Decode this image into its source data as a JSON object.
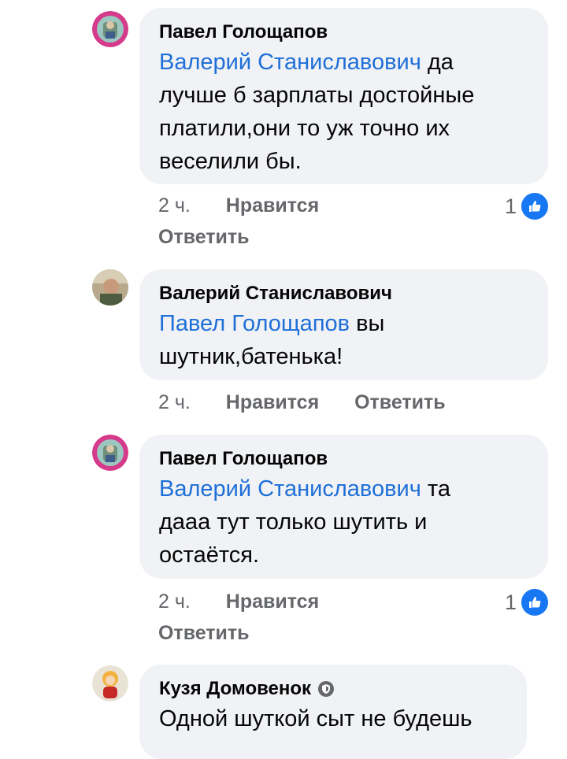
{
  "comments": [
    {
      "author": "Павел Голощапов",
      "mention": "Валерий Станиславович",
      "text_lines": [
        " да",
        "лучше б зарплаты достойные",
        "платили,они то уж точно их",
        "веселили бы."
      ],
      "time": "2 ч.",
      "like_label": "Нравится",
      "reply_label": "Ответить",
      "reaction_count": "1",
      "reaction_icon": "like-icon"
    },
    {
      "author": "Валерий Станиславович",
      "mention": "Павел Голощапов",
      "text_lines": [
        " вы",
        "шутник,батенька!"
      ],
      "time": "2 ч.",
      "like_label": "Нравится",
      "reply_label": "Ответить"
    },
    {
      "author": "Павел Голощапов",
      "mention": "Валерий Станиславович",
      "text_lines": [
        " та",
        "дааа тут только шутить и",
        "остаётся."
      ],
      "time": "2 ч.",
      "like_label": "Нравится",
      "reply_label": "Ответить",
      "reaction_count": "1",
      "reaction_icon": "like-icon"
    },
    {
      "author": "Кузя Домовенок",
      "author_badge": "shield-badge-icon",
      "text_lines": [
        "Одной шуткой сыт не будешь"
      ]
    }
  ],
  "colors": {
    "bubble": "#f0f2f5",
    "mention": "#1f6fd8",
    "meta": "#65676b",
    "like": "#1877f2"
  }
}
